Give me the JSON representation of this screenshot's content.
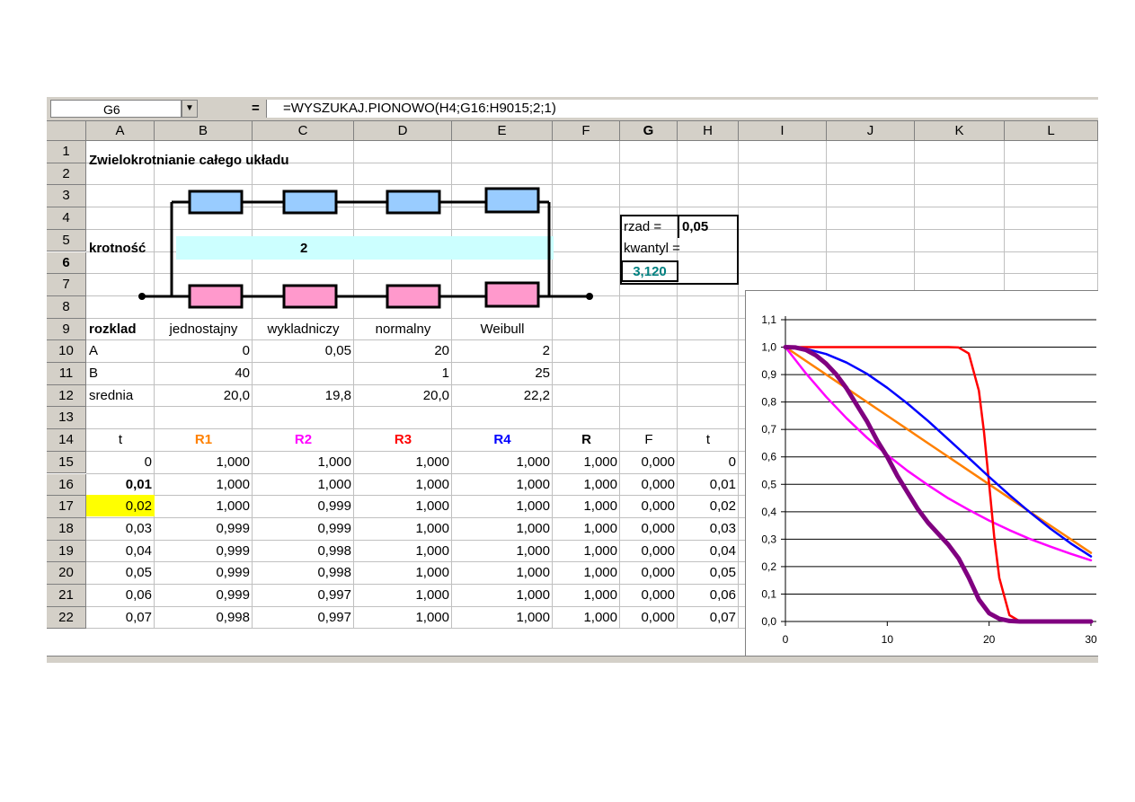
{
  "formula_bar": {
    "name_box": "G6",
    "equals": "=",
    "formula": "=WYSZUKAJ.PIONOWO(H4;G16:H9015;2;1)"
  },
  "columns": [
    "A",
    "B",
    "C",
    "D",
    "E",
    "F",
    "G",
    "H",
    "I",
    "J",
    "K",
    "L"
  ],
  "rows": [
    "1",
    "2",
    "3",
    "4",
    "5",
    "6",
    "7",
    "8",
    "9",
    "10",
    "11",
    "12",
    "13",
    "14",
    "15",
    "16",
    "17",
    "18",
    "19",
    "20",
    "21",
    "22"
  ],
  "title": "Zwielokrotnianie całego układu",
  "krotnosc": {
    "label": "krotność",
    "value": "2"
  },
  "quantile_box": {
    "rzad_label": "rzad =",
    "rzad_value": "0,05",
    "kwantyl_label": "kwantyl =",
    "kwantyl_value": "3,120"
  },
  "params": {
    "header": [
      "rozklad",
      "jednostajny",
      "wykladniczy",
      "normalny",
      "Weibull"
    ],
    "rows": [
      [
        "A",
        "0",
        "0,05",
        "20",
        "2"
      ],
      [
        "B",
        "40",
        "",
        "1",
        "25"
      ],
      [
        "srednia",
        "20,0",
        "19,8",
        "20,0",
        "22,2"
      ]
    ]
  },
  "table_header": [
    "t",
    "R1",
    "R2",
    "R3",
    "R4",
    "R",
    "F",
    "t"
  ],
  "table_rows": [
    [
      "0",
      "1,000",
      "1,000",
      "1,000",
      "1,000",
      "1,000",
      "0,000",
      "0"
    ],
    [
      "0,01",
      "1,000",
      "1,000",
      "1,000",
      "1,000",
      "1,000",
      "0,000",
      "0,01"
    ],
    [
      "0,02",
      "1,000",
      "0,999",
      "1,000",
      "1,000",
      "1,000",
      "0,000",
      "0,02"
    ],
    [
      "0,03",
      "0,999",
      "0,999",
      "1,000",
      "1,000",
      "1,000",
      "0,000",
      "0,03"
    ],
    [
      "0,04",
      "0,999",
      "0,998",
      "1,000",
      "1,000",
      "1,000",
      "0,000",
      "0,04"
    ],
    [
      "0,05",
      "0,999",
      "0,998",
      "1,000",
      "1,000",
      "1,000",
      "0,000",
      "0,05"
    ],
    [
      "0,06",
      "0,999",
      "0,997",
      "1,000",
      "1,000",
      "1,000",
      "0,000",
      "0,06"
    ],
    [
      "0,07",
      "0,998",
      "0,997",
      "1,000",
      "1,000",
      "1,000",
      "0,000",
      "0,07"
    ]
  ],
  "colors": {
    "R1": "#ff8000",
    "R2": "#ff00ff",
    "R3": "#ff0000",
    "R4": "#0000ff",
    "R": "#800080",
    "block_blue": "#99ccff",
    "block_pink": "#ff99cc",
    "krotnosc_fill": "#ccffff",
    "highlight": "#ffff00",
    "quantile_text": "#008080"
  },
  "chart_data": {
    "type": "line",
    "title": "",
    "xlabel": "",
    "ylabel": "",
    "xlim": [
      0,
      30
    ],
    "ylim": [
      0,
      1.1
    ],
    "x_ticks": [
      "0",
      "10",
      "20",
      "30"
    ],
    "y_ticks": [
      "0,0",
      "0,1",
      "0,2",
      "0,3",
      "0,4",
      "0,5",
      "0,6",
      "0,7",
      "0,8",
      "0,9",
      "1,0",
      "1,1"
    ],
    "grid": "horizontal",
    "series": [
      {
        "key": "R1",
        "color": "#ff8000",
        "width": 2.5,
        "x": [
          0,
          5,
          10,
          15,
          20,
          25,
          30
        ],
        "y": [
          1.0,
          0.875,
          0.75,
          0.625,
          0.5,
          0.375,
          0.25
        ]
      },
      {
        "key": "R2",
        "color": "#ff00ff",
        "width": 2.5,
        "x": [
          0,
          2,
          4,
          6,
          8,
          10,
          12,
          14,
          16,
          18,
          20,
          22,
          24,
          26,
          28,
          30
        ],
        "y": [
          1.0,
          0.905,
          0.819,
          0.741,
          0.67,
          0.607,
          0.549,
          0.497,
          0.449,
          0.407,
          0.368,
          0.333,
          0.301,
          0.273,
          0.247,
          0.223
        ]
      },
      {
        "key": "R3",
        "color": "#ff0000",
        "width": 2.5,
        "x": [
          0,
          15,
          16,
          17,
          18,
          19,
          19.5,
          20,
          20.5,
          21,
          22,
          23,
          25,
          30
        ],
        "y": [
          1.0,
          1.0,
          1.0,
          0.999,
          0.977,
          0.841,
          0.69,
          0.5,
          0.31,
          0.159,
          0.023,
          0.001,
          0,
          0
        ]
      },
      {
        "key": "R4",
        "color": "#0000ff",
        "width": 2.5,
        "x": [
          0,
          2,
          4,
          6,
          8,
          10,
          12,
          14,
          16,
          18,
          20,
          22,
          24,
          26,
          28,
          30
        ],
        "y": [
          1.0,
          0.994,
          0.975,
          0.944,
          0.903,
          0.852,
          0.794,
          0.731,
          0.664,
          0.596,
          0.527,
          0.461,
          0.398,
          0.339,
          0.285,
          0.237
        ]
      },
      {
        "key": "R",
        "color": "#800080",
        "width": 5,
        "x": [
          0,
          1,
          2,
          3,
          4,
          5,
          6,
          7,
          8,
          9,
          10,
          11,
          12,
          13,
          14,
          15,
          16,
          17,
          18,
          19,
          20,
          21,
          22,
          23,
          25,
          30
        ],
        "y": [
          1.0,
          0.999,
          0.99,
          0.97,
          0.94,
          0.9,
          0.85,
          0.79,
          0.73,
          0.66,
          0.6,
          0.53,
          0.47,
          0.41,
          0.36,
          0.32,
          0.28,
          0.23,
          0.16,
          0.08,
          0.03,
          0.01,
          0.002,
          0.0,
          0.0,
          0.0
        ]
      }
    ]
  }
}
